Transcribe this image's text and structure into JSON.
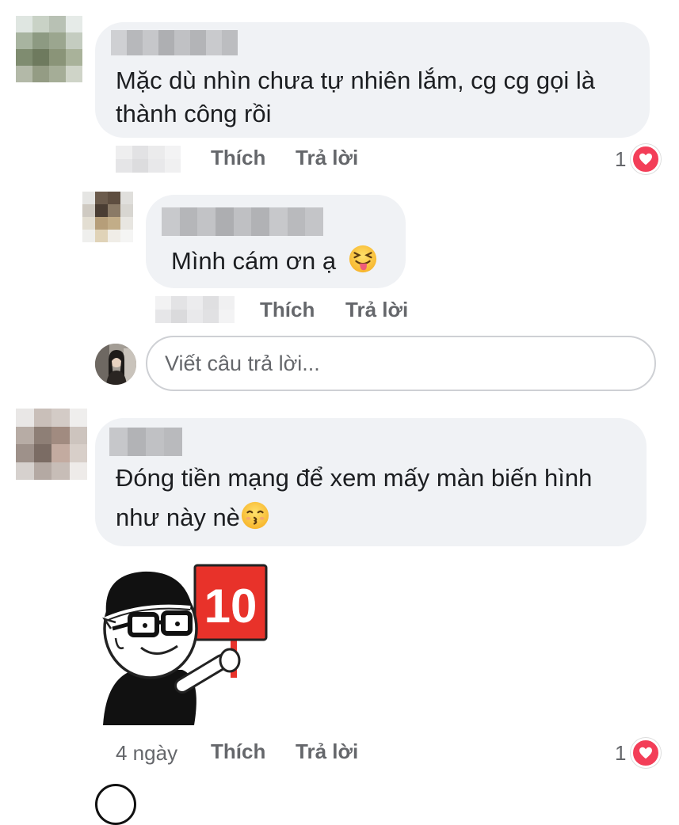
{
  "comment1": {
    "text_line1": "Mặc dù nhìn chưa tự nhiên lắm, cg cg gọi là",
    "text_line2": "thành công rồi",
    "like_label": "Thích",
    "reply_label": "Trả lời",
    "reaction_count": "1",
    "reaction_icon": "heart-icon"
  },
  "reply1": {
    "text": "Mình cám ơn ạ",
    "emoji": "squinting-face-with-tongue-icon",
    "like_label": "Thích",
    "reply_label": "Trả lời"
  },
  "reply_input": {
    "placeholder": "Viết câu trả lời..."
  },
  "comment2": {
    "text_line1": "Đóng tiền mạng để xem mấy màn biến hình",
    "text_line2": "như này nè",
    "emoji": "kissing-face-icon",
    "sticker_sign": "10",
    "sticker": "judge-holding-score-sign-sticker",
    "time": "4 ngày",
    "like_label": "Thích",
    "reply_label": "Trả lời",
    "reaction_count": "1",
    "reaction_icon": "heart-icon"
  },
  "colors": {
    "bubble": "#f0f2f5",
    "action_text": "#65676b",
    "heart": "#f33e58",
    "sign_red": "#e8322a"
  }
}
